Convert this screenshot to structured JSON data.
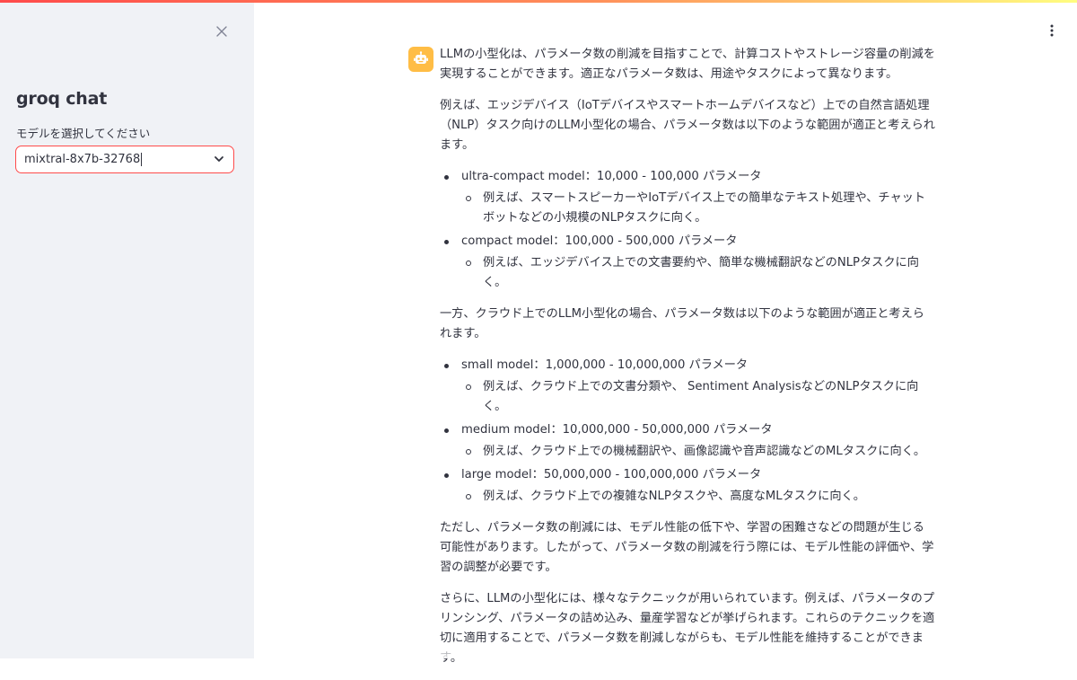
{
  "sidebar": {
    "title": "groq chat",
    "select_label": "モデルを選択してください",
    "select_value": "mixtral-8x7b-32768",
    "close_icon": "close-icon",
    "chevron_icon": "chevron-down-icon"
  },
  "header": {
    "menu_icon": "kebab-menu-icon"
  },
  "colors": {
    "accent": "#ff4b4b",
    "avatar": "#ffbd45",
    "sidebar_bg": "#f0f2f6",
    "text": "#31333f"
  },
  "message": {
    "avatar_icon": "robot-icon",
    "p1": "LLMの小型化は、パラメータ数の削減を目指すことで、計算コストやストレージ容量の削減を実現することができます。適正なパラメータ数は、用途やタスクによって異なります。",
    "p2": "例えば、エッジデバイス（IoTデバイスやスマートホームデバイスなど）上での自然言語処理（NLP）タスク向けのLLM小型化の場合、パラメータ数は以下のような範囲が適正と考えられます。",
    "list1": [
      {
        "label": "ultra-compact model：10,000 - 100,000 パラメータ",
        "sub": "例えば、スマートスピーカーやIoTデバイス上での簡単なテキスト処理や、チャットボットなどの小規模のNLPタスクに向く。"
      },
      {
        "label": "compact model：100,000 - 500,000 パラメータ",
        "sub": "例えば、エッジデバイス上での文書要約や、簡単な機械翻訳などのNLPタスクに向く。"
      }
    ],
    "p3": "一方、クラウド上でのLLM小型化の場合、パラメータ数は以下のような範囲が適正と考えられます。",
    "list2": [
      {
        "label": "small model：1,000,000 - 10,000,000 パラメータ",
        "sub": "例えば、クラウド上での文書分類や、 Sentiment AnalysisなどのNLPタスクに向く。"
      },
      {
        "label": "medium model：10,000,000 - 50,000,000 パラメータ",
        "sub": "例えば、クラウド上での機械翻訳や、画像認識や音声認識などのMLタスクに向く。"
      },
      {
        "label": "large model：50,000,000 - 100,000,000 パラメータ",
        "sub": "例えば、クラウド上での複雑なNLPタスクや、高度なMLタスクに向く。"
      }
    ],
    "p4": "ただし、パラメータ数の削減には、モデル性能の低下や、学習の困難さなどの問題が生じる可能性があります。したがって、パラメータ数の削減を行う際には、モデル性能の評価や、学習の調整が必要です。",
    "p5": "さらに、LLMの小型化には、様々なテクニックが用いられています。例えば、パラメータのプリンシング、パラメータの詰め込み、量産学習などが挙げられます。これらのテクニックを適切に適用することで、パラメータ数を削減しながらも、モデル性能を維持することができます。"
  }
}
